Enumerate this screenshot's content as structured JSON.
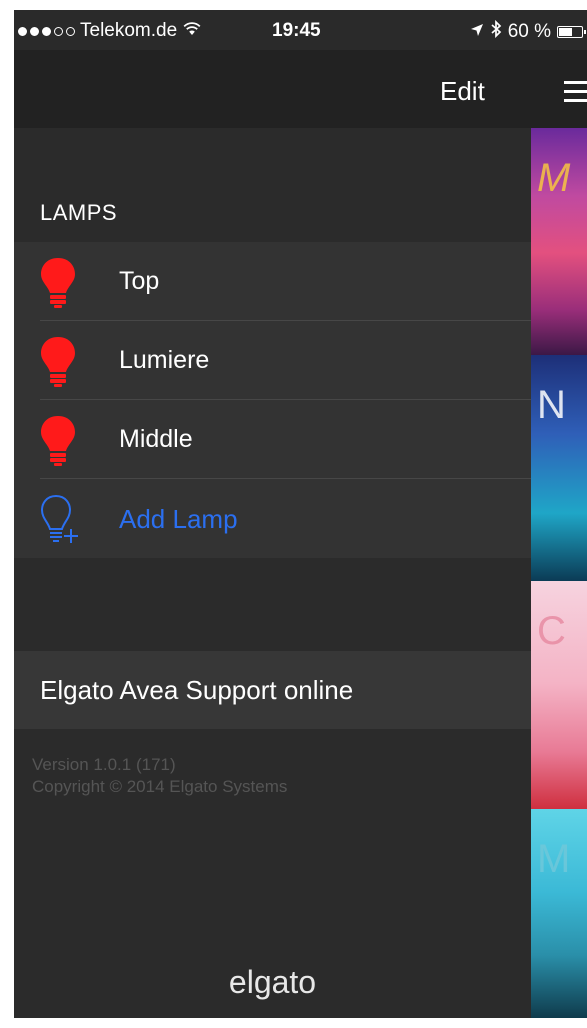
{
  "status_bar": {
    "carrier": "Telekom.de",
    "time": "19:45",
    "battery": "60 %",
    "battery_level": 0.6,
    "signal_bars_filled": 3,
    "signal_bars_total": 5
  },
  "nav": {
    "edit_label": "Edit"
  },
  "menu": {
    "section_title": "LAMPS",
    "lamps": [
      {
        "label": "Top",
        "icon": "red-bulb-icon",
        "color": "#ff1a1a"
      },
      {
        "label": "Lumiere",
        "icon": "red-bulb-icon",
        "color": "#ff1a1a"
      },
      {
        "label": "Middle",
        "icon": "red-bulb-icon",
        "color": "#ff1a1a"
      }
    ],
    "add_lamp": {
      "label": "Add Lamp",
      "icon": "add-bulb-icon",
      "color": "#2b6ff0"
    },
    "support_label": "Elgato Avea Support online",
    "version": "Version 1.0.1 (171)",
    "copyright": "Copyright © 2014 Elgato Systems",
    "brand": "elgato"
  },
  "scenes": [
    {
      "letter": "M"
    },
    {
      "letter": "N"
    },
    {
      "letter": "C"
    },
    {
      "letter": "M"
    }
  ]
}
